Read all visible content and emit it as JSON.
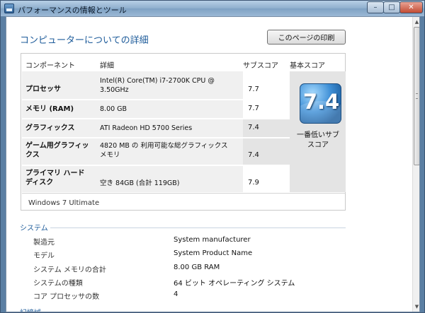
{
  "window": {
    "title": "パフォーマンスの情報とツール"
  },
  "title_buttons": {
    "minimize": "–",
    "maximize": "□",
    "close": "✕"
  },
  "heading": "コンピューターについての詳細",
  "print_button": "このページの印刷",
  "table": {
    "headers": {
      "component": "コンポーネント",
      "detail": "詳細",
      "subscore": "サブスコア",
      "basescore": "基本スコア"
    },
    "rows": [
      {
        "component": "プロセッサ",
        "detail": "Intel(R) Core(TM) i7-2700K CPU @ 3.50GHz",
        "subscore": "7.7"
      },
      {
        "component": "メモリ (RAM)",
        "detail": "8.00 GB",
        "subscore": "7.7"
      },
      {
        "component": "グラフィックス",
        "detail": "ATI Radeon HD 5700 Series",
        "subscore": "7.4"
      },
      {
        "component": "ゲーム用グラフィックス",
        "detail": "4820 MB の 利用可能な総グラフィックス メモリ",
        "subscore": "7.4"
      },
      {
        "component": "プライマリ ハード ディスク",
        "detail": "空き 84GB (合計 119GB)",
        "subscore": "7.9"
      }
    ],
    "base_score": "7.4",
    "base_caption": "一番低いサブスコア",
    "edition": "Windows 7 Ultimate"
  },
  "system": {
    "title": "システム",
    "items": [
      {
        "label": "製造元",
        "value": "System manufacturer"
      },
      {
        "label": "モデル",
        "value": "System Product Name"
      },
      {
        "label": "システム メモリの合計",
        "value": "8.00 GB RAM"
      },
      {
        "label": "システムの種類",
        "value": "64 ビット オペレーティング システム"
      },
      {
        "label": "コア プロセッサの数",
        "value": "4"
      }
    ]
  },
  "next_section_title": "記憶域",
  "colors": {
    "accent": "#1d5b9a",
    "badge": "#3e8fd6",
    "panel_gray": "#f0f0f0"
  }
}
